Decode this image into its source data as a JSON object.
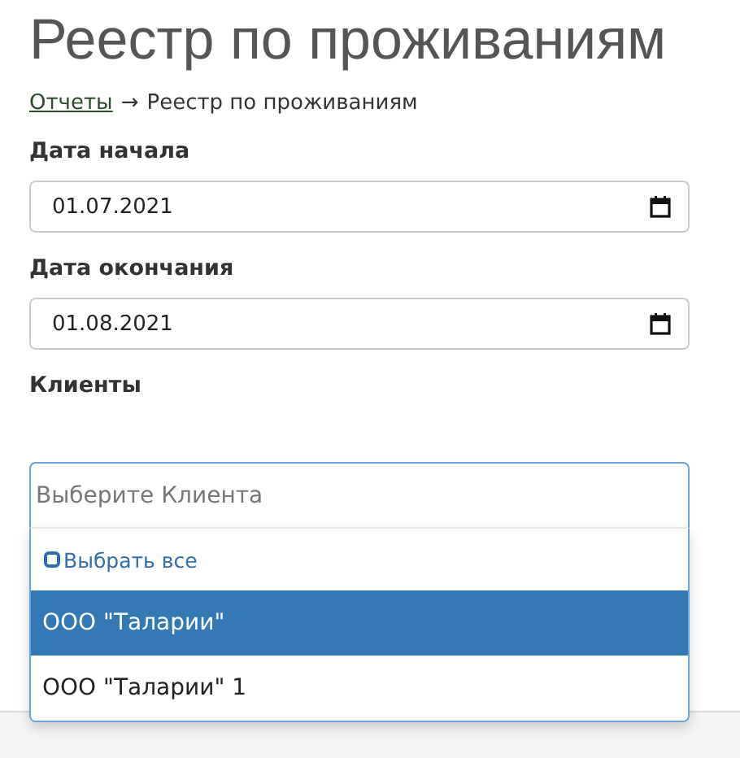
{
  "title": "Реестр по проживаниям",
  "breadcrumb": {
    "link": "Отчеты",
    "separator": "→",
    "current": "Реестр по проживаниям"
  },
  "date_fields": [
    {
      "label": "Дата начала",
      "value": "01.07.2021"
    },
    {
      "label": "Дата окончания",
      "value": "01.08.2021"
    }
  ],
  "clients": {
    "label": "Клиенты",
    "placeholder": "Выберите Клиента",
    "select_all": {
      "label": "Выбрать все",
      "checked": false
    },
    "options": [
      {
        "label": "ООО \"Таларии\"",
        "selected": true
      },
      {
        "label": "ООО \"Таларии\" 1",
        "selected": false
      }
    ]
  }
}
